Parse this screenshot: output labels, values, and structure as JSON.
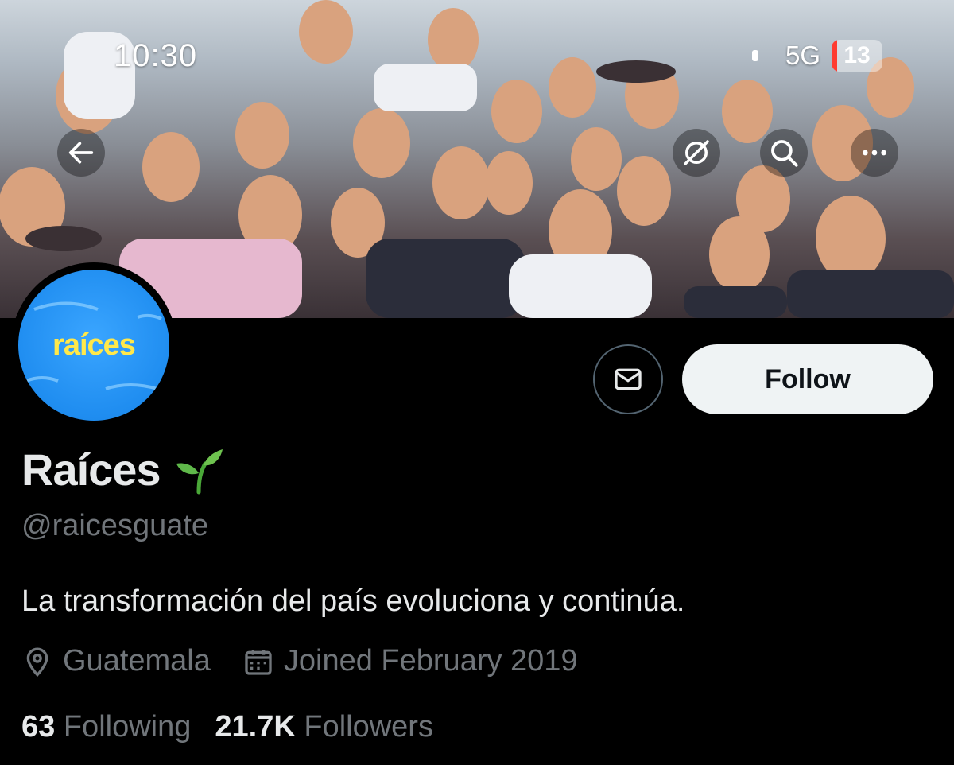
{
  "status_bar": {
    "time": "10:30",
    "network": "5G",
    "battery": "13"
  },
  "header": {
    "back_icon": "arrow-left-icon",
    "actions": [
      "spaces-icon",
      "search-icon",
      "more-icon"
    ]
  },
  "profile": {
    "avatar_text": "raíces",
    "name": "Raíces",
    "name_emoji": "seedling-icon",
    "handle": "@raicesguate",
    "bio": "La transformación del país evoluciona y continúa.",
    "location": "Guatemala",
    "joined": "Joined February 2019",
    "following_count": "63",
    "following_label": "Following",
    "followers_count": "21.7K",
    "followers_label": "Followers"
  },
  "buttons": {
    "follow_label": "Follow",
    "message_icon": "mail-icon"
  },
  "colors": {
    "background": "#000000",
    "text": "#e7e9ea",
    "muted": "#71767b",
    "avatar_bg": "#1f8df0",
    "avatar_text": "#ffe84a",
    "emoji_green": "#5fb84a"
  }
}
